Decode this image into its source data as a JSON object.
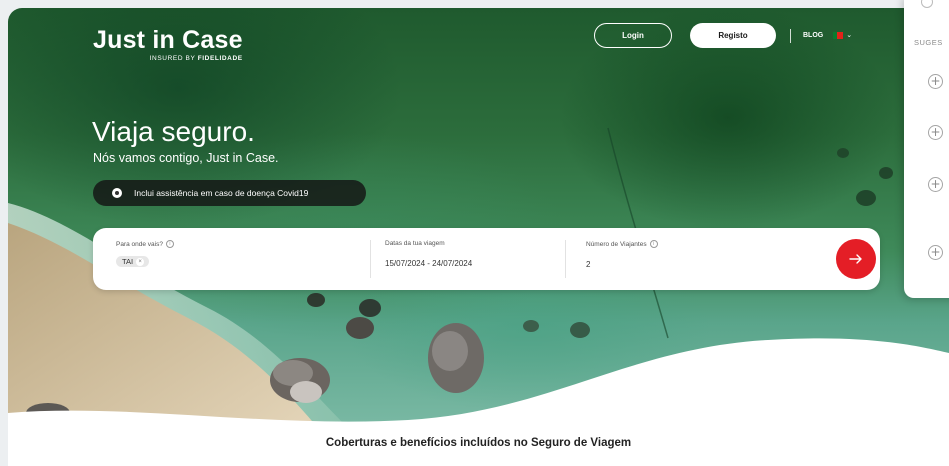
{
  "brand": {
    "name": "Just in Case",
    "tagline_prefix": "INSURED BY",
    "tagline_brand": "FIDELIDADE"
  },
  "nav": {
    "login": "Login",
    "register": "Registo",
    "blog": "BLOG",
    "language_chevron": "⌄"
  },
  "hero": {
    "title": "Viaja seguro.",
    "subtitle": "Nós vamos contigo, Just in Case.",
    "covid_notice": "Inclui assistência em caso de doença Covid19"
  },
  "search": {
    "destination": {
      "label": "Para onde vais?",
      "info": "i",
      "chips": [
        {
          "value": "TAI",
          "remove": "×"
        }
      ]
    },
    "dates": {
      "label": "Datas da tua viagem",
      "value": "15/07/2024 - 24/07/2024"
    },
    "travelers": {
      "label": "Número de Viajantes",
      "info": "i",
      "value": "2"
    }
  },
  "section": {
    "heading": "Coberturas e benefícios incluídos no Seguro de Viagem"
  },
  "suggestions": {
    "label": "SUGES",
    "add_symbol": "+"
  },
  "colors": {
    "accent": "#e41e26",
    "text_dark": "#222222"
  }
}
